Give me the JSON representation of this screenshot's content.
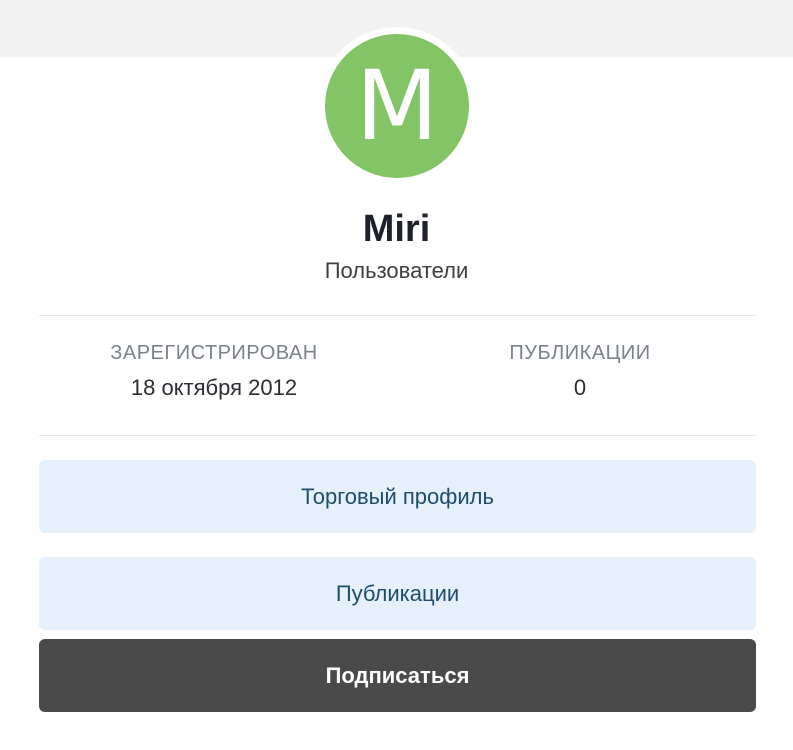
{
  "profile": {
    "avatar_letter": "M",
    "avatar_color": "#82c466",
    "name": "Miri",
    "group": "Пользователи"
  },
  "stats": {
    "registered_label": "ЗАРЕГИСТРИРОВАН",
    "registered_value": "18 октября 2012",
    "posts_label": "ПУБЛИКАЦИИ",
    "posts_value": "0"
  },
  "actions": {
    "trade_profile_label": "Торговый профиль",
    "publications_label": "Публикации",
    "subscribe_label": "Подписаться"
  },
  "colors": {
    "light_button_bg": "#e5f0fa",
    "dark_button_bg": "#4a4a4a"
  }
}
